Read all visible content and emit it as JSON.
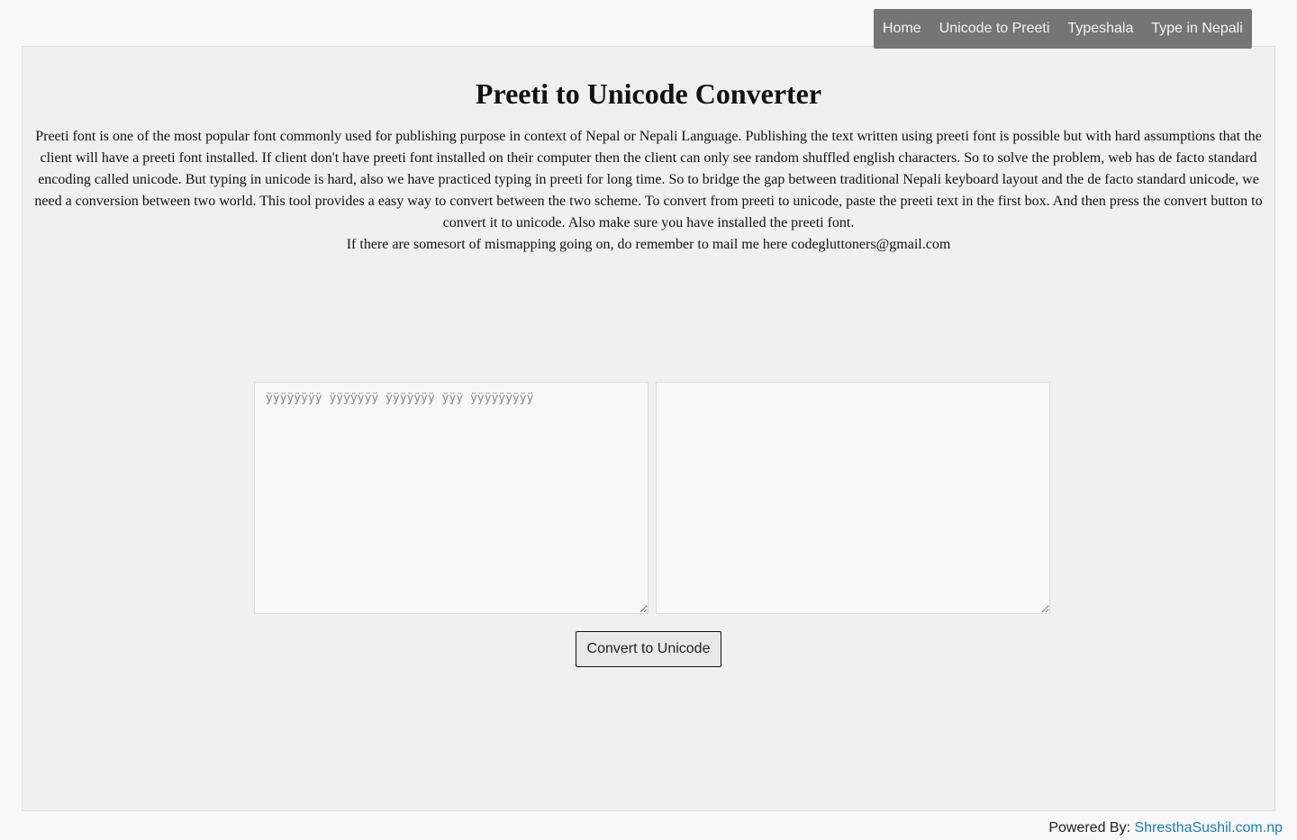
{
  "nav": {
    "items": [
      {
        "label": "Home"
      },
      {
        "label": "Unicode to Preeti"
      },
      {
        "label": "Typeshala"
      },
      {
        "label": "Type in Nepali"
      }
    ]
  },
  "main": {
    "title": "Preeti to Unicode Converter",
    "description": "Preeti font is one of the most popular font commonly used for publishing purpose in context of Nepal or Nepali Language. Publishing the text written using preeti font is possible but with hard assumptions that the client will have a preeti font installed. If client don't have preeti font installed on their computer then the client can only see random shuffled english characters. So to solve the problem, web has de facto standard encoding called unicode. But typing in unicode is hard, also we have practiced typing in preeti for long time. So to bridge the gap between traditional Nepali keyboard layout and the de facto standard unicode, we need a conversion between two world. This tool provides a easy way to convert between the two scheme. To convert from preeti to unicode, paste the preeti text in the first box. And then press the convert button to convert it to unicode. Also make sure you have installed the preeti font.",
    "contact": "If there are somesort of mismapping going on, do remember to mail me here codegluttoners@gmail.com",
    "input": {
      "value": "",
      "placeholder": "ÿÿÿÿÿÿÿÿ ÿÿÿÿÿÿÿ ÿÿÿÿÿÿÿ ÿÿÿ ÿÿÿÿÿÿÿÿÿ"
    },
    "output": {
      "value": "",
      "placeholder": ""
    },
    "convert_label": "Convert to Unicode"
  },
  "footer": {
    "prefix": "Powered By: ",
    "link_label": "ShresthaSushil.com.np"
  }
}
